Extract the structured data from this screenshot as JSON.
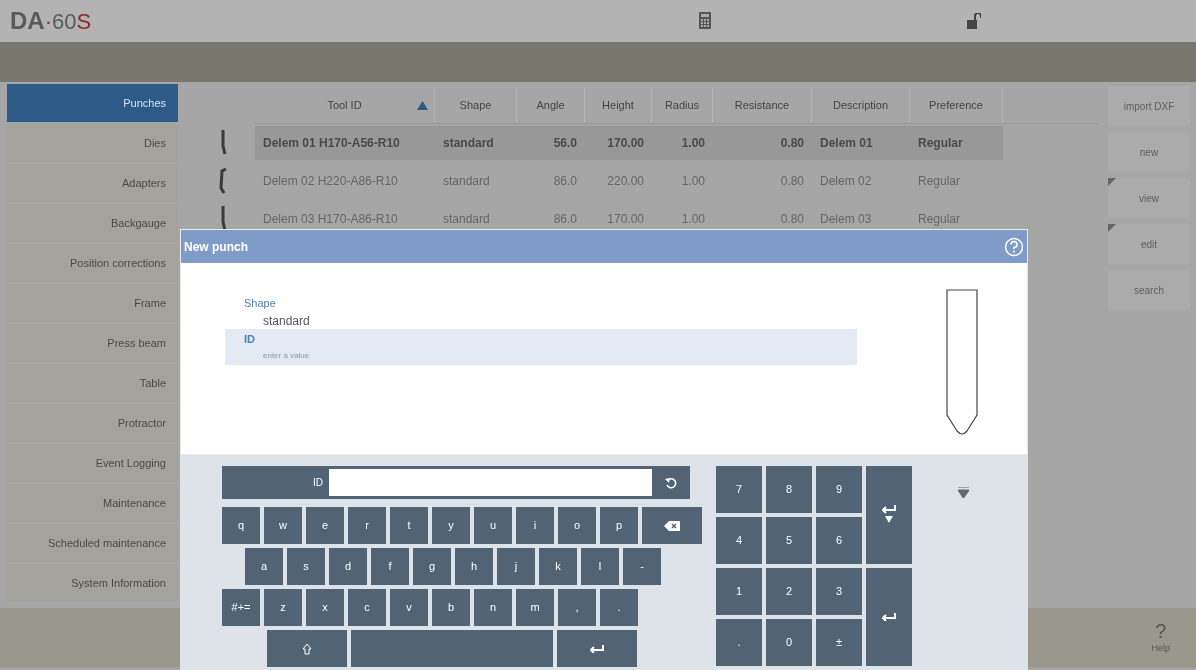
{
  "header": {
    "logo": [
      {
        "text": "DA",
        "kind": "bold"
      },
      {
        "text": "·",
        "kind": "accent"
      },
      {
        "text": "60",
        "kind": "plain"
      },
      {
        "text": "S",
        "kind": "accent"
      }
    ]
  },
  "sidebar": {
    "items": [
      {
        "label": "Punches",
        "selected": true
      },
      {
        "label": "Dies",
        "selected": false
      },
      {
        "label": "Adapters",
        "selected": false
      },
      {
        "label": "Backgauge",
        "selected": false
      },
      {
        "label": "Position corrections",
        "selected": false
      },
      {
        "label": "Frame",
        "selected": false
      },
      {
        "label": "Press beam",
        "selected": false
      },
      {
        "label": "Table",
        "selected": false
      },
      {
        "label": "Protractor",
        "selected": false
      },
      {
        "label": "Event Logging",
        "selected": false
      },
      {
        "label": "Maintenance",
        "selected": false
      },
      {
        "label": "Scheduled maintenance",
        "selected": false
      },
      {
        "label": "System Information",
        "selected": false
      }
    ]
  },
  "table": {
    "columns": [
      {
        "label": "Tool ID",
        "kind": "text",
        "sorted": true
      },
      {
        "label": "Shape",
        "kind": "text",
        "sorted": false
      },
      {
        "label": "Angle",
        "kind": "number",
        "sorted": false
      },
      {
        "label": "Height",
        "kind": "number",
        "sorted": false
      },
      {
        "label": "Radius",
        "kind": "number",
        "sorted": false
      },
      {
        "label": "Resistance",
        "kind": "number",
        "sorted": false
      },
      {
        "label": "Description",
        "kind": "text",
        "sorted": false
      },
      {
        "label": "Preference",
        "kind": "text",
        "sorted": false
      }
    ],
    "rows": [
      {
        "selected": true,
        "cells": [
          "Delem 01 H170-A56-R10",
          "standard",
          "56.0",
          "170.00",
          "1.00",
          "0.80",
          "Delem 01",
          "Regular"
        ]
      },
      {
        "selected": false,
        "cells": [
          "Delem 02 H220-A86-R10",
          "standard",
          "86.0",
          "220.00",
          "1.00",
          "0.80",
          "Delem 02",
          "Regular"
        ]
      },
      {
        "selected": false,
        "cells": [
          "Delem 03 H170-A86-R10",
          "standard",
          "86.0",
          "170.00",
          "1.00",
          "0.80",
          "Delem 03",
          "Regular"
        ]
      }
    ]
  },
  "side_buttons": [
    {
      "label": "import DXF",
      "has_menu": false
    },
    {
      "label": "new",
      "has_menu": false
    },
    {
      "label": "view",
      "has_menu": true
    },
    {
      "label": "edit",
      "has_menu": true
    },
    {
      "label": "search",
      "has_menu": false
    }
  ],
  "help": {
    "glyph": "?",
    "label": "Help"
  },
  "dialog": {
    "title": "New punch",
    "fields": [
      {
        "label": "Shape",
        "value": "standard",
        "focused": false
      },
      {
        "label": "ID",
        "placeholder": "enter a value",
        "focused": true
      }
    ]
  },
  "keyboard": {
    "field_label": "ID",
    "rows": [
      [
        {
          "kind": "char",
          "text": "q"
        },
        {
          "kind": "char",
          "text": "w"
        },
        {
          "kind": "char",
          "text": "e"
        },
        {
          "kind": "char",
          "text": "r"
        },
        {
          "kind": "char",
          "text": "t"
        },
        {
          "kind": "char",
          "text": "y"
        },
        {
          "kind": "char",
          "text": "u"
        },
        {
          "kind": "char",
          "text": "i"
        },
        {
          "kind": "char",
          "text": "o"
        },
        {
          "kind": "char",
          "text": "p"
        },
        {
          "kind": "backspace"
        }
      ],
      [
        {
          "kind": "char",
          "text": "a"
        },
        {
          "kind": "char",
          "text": "s"
        },
        {
          "kind": "char",
          "text": "d"
        },
        {
          "kind": "char",
          "text": "f"
        },
        {
          "kind": "char",
          "text": "g"
        },
        {
          "kind": "char",
          "text": "h"
        },
        {
          "kind": "char",
          "text": "j"
        },
        {
          "kind": "char",
          "text": "k"
        },
        {
          "kind": "char",
          "text": "l"
        },
        {
          "kind": "char",
          "text": "-"
        }
      ],
      [
        {
          "kind": "char",
          "text": "#+="
        },
        {
          "kind": "char",
          "text": "z"
        },
        {
          "kind": "char",
          "text": "x"
        },
        {
          "kind": "char",
          "text": "c"
        },
        {
          "kind": "char",
          "text": "v"
        },
        {
          "kind": "char",
          "text": "b"
        },
        {
          "kind": "char",
          "text": "n"
        },
        {
          "kind": "char",
          "text": "m"
        },
        {
          "kind": "char",
          "text": ","
        },
        {
          "kind": "char",
          "text": "."
        }
      ],
      [
        {
          "kind": "shift"
        },
        {
          "kind": "space"
        },
        {
          "kind": "enter"
        }
      ]
    ],
    "numpad": [
      {
        "kind": "char",
        "text": "7"
      },
      {
        "kind": "char",
        "text": "8"
      },
      {
        "kind": "char",
        "text": "9"
      },
      {
        "kind": "enter_down"
      },
      {
        "kind": "char",
        "text": "4"
      },
      {
        "kind": "char",
        "text": "5"
      },
      {
        "kind": "char",
        "text": "6"
      },
      {
        "kind": "char",
        "text": "1"
      },
      {
        "kind": "char",
        "text": "2"
      },
      {
        "kind": "char",
        "text": "3"
      },
      {
        "kind": "enter"
      },
      {
        "kind": "char",
        "text": "."
      },
      {
        "kind": "char",
        "text": "0"
      },
      {
        "kind": "char",
        "text": "±"
      }
    ]
  }
}
